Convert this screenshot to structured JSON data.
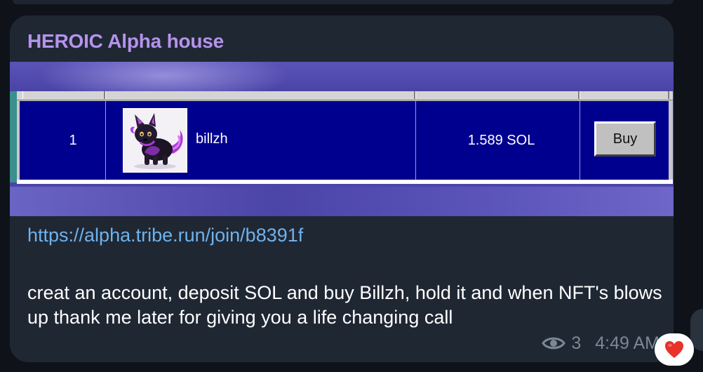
{
  "message": {
    "sender": "HEROIC Alpha house",
    "link": "https://alpha.tribe.run/join/b8391f",
    "text": "creat an account, deposit SOL and buy Billzh, hold it and when NFT's blows up thank me later for giving you a life changing call",
    "views": "3",
    "time": "4:49 AM"
  },
  "media": {
    "leaderboard": {
      "row": {
        "rank": "1",
        "name": "billzh",
        "price": "1.589 SOL",
        "buy_label": "Buy"
      }
    }
  },
  "reaction": {
    "emoji": "heart",
    "color": "#e8322a"
  },
  "colors": {
    "sender_name": "#b593eb",
    "link": "#6fb2ec",
    "bubble": "#1f2733",
    "leaderboard_row": "#00008f"
  }
}
